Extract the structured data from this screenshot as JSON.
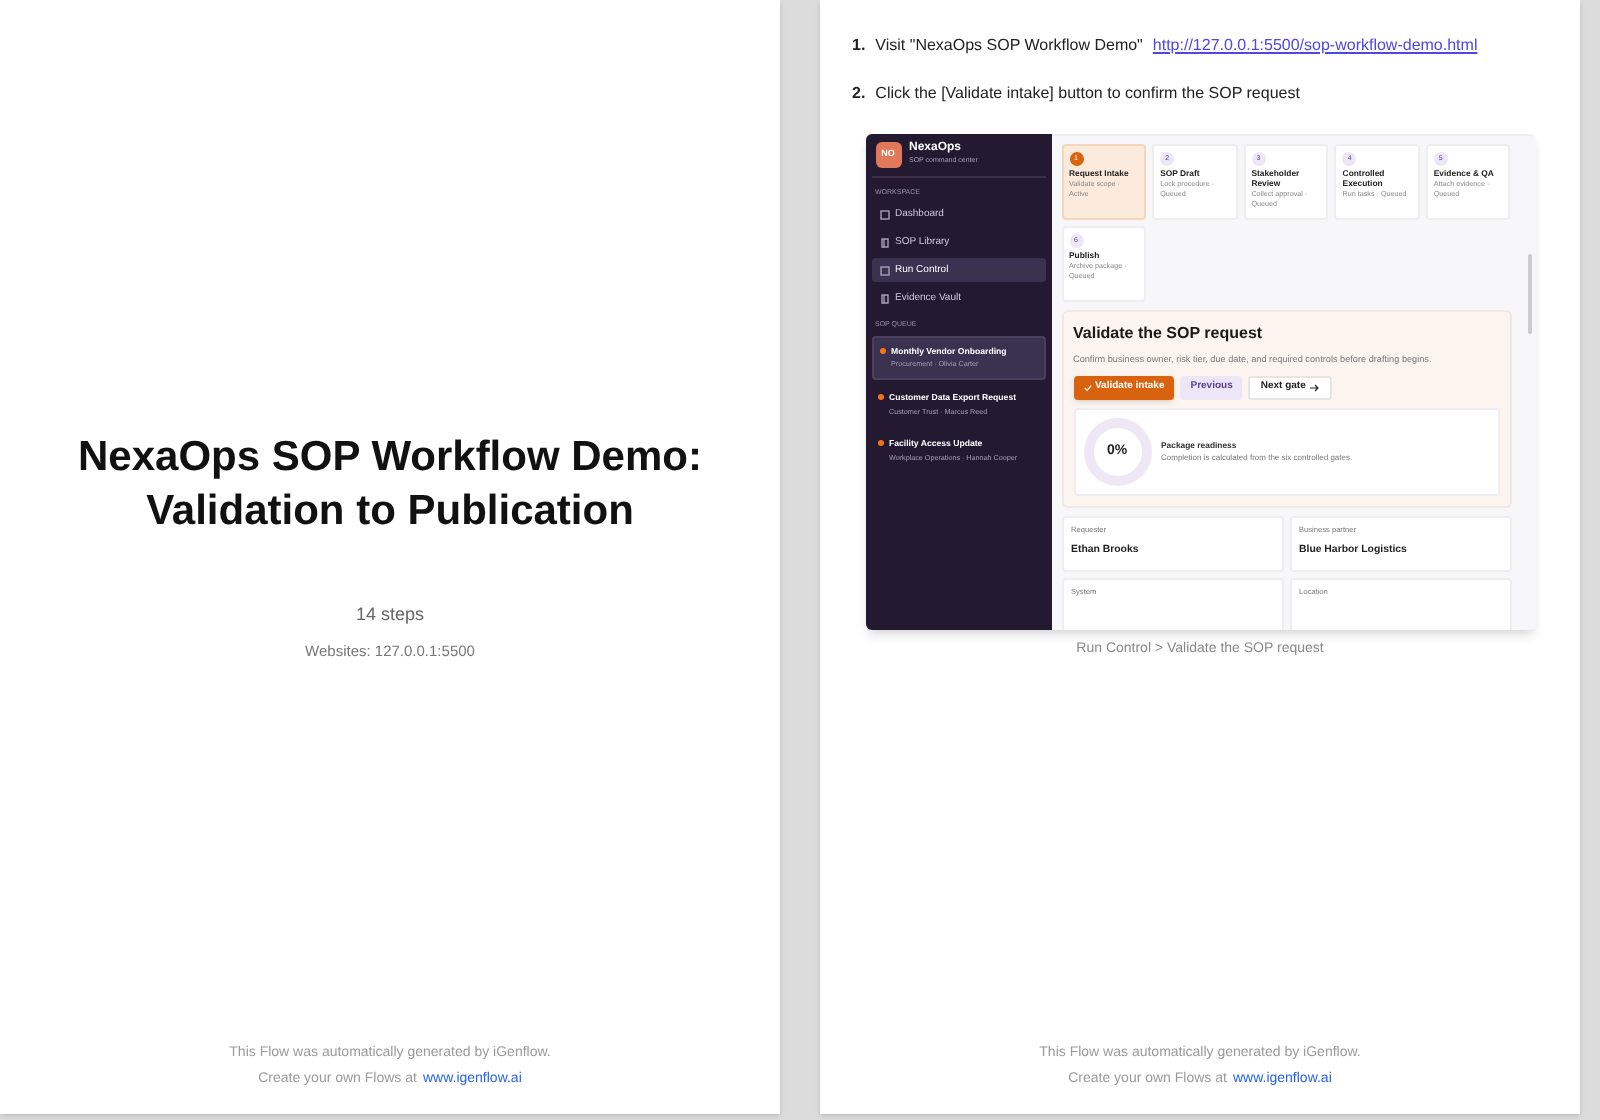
{
  "left_page": {
    "title": "NexaOps SOP Workflow Demo: Validation to Publication",
    "steps_count": "14 steps",
    "websites": "Websites: 127.0.0.1:5500",
    "footer": {
      "note": "This Flow was automatically generated by iGenflow.",
      "cta": "Create your own Flows at",
      "link": "www.igenflow.ai"
    }
  },
  "right_page": {
    "steps": [
      {
        "number": "1.",
        "text": "Visit \"NexaOps SOP Workflow Demo\"",
        "link": "http://127.0.0.1:5500/sop-workflow-demo.html"
      },
      {
        "number": "2.",
        "text": "Click the [Validate intake] button to confirm the SOP request"
      }
    ],
    "screenshot": {
      "brand": {
        "initials": "NO",
        "name": "NexaOps",
        "subtitle": "SOP command center"
      },
      "workspace_label": "WORKSPACE",
      "nav": [
        {
          "label": "Dashboard",
          "selected": false
        },
        {
          "label": "SOP Library",
          "selected": false
        },
        {
          "label": "Run Control",
          "selected": true
        },
        {
          "label": "Evidence Vault",
          "selected": false
        }
      ],
      "queue_label": "SOP QUEUE",
      "queue": [
        {
          "title": "Monthly Vendor Onboarding",
          "meta": "Procurement · Olivia Carter",
          "selected": true,
          "color": "#f97316"
        },
        {
          "title": "Customer Data Export Request",
          "meta": "Customer Trust · Marcus Reed",
          "selected": false,
          "color": "#f97316"
        },
        {
          "title": "Facility Access Update",
          "meta": "Workplace Operations · Hannah Cooper",
          "selected": false,
          "color": "#f97316"
        }
      ],
      "gates": [
        {
          "number": "1",
          "title": "Request Intake",
          "status": "Validate scope · Active",
          "selected": true
        },
        {
          "number": "2",
          "title": "SOP Draft",
          "status": "Lock procedure · Queued",
          "selected": false
        },
        {
          "number": "3",
          "title": "Stakeholder Review",
          "status": "Collect approval · Queued",
          "selected": false
        },
        {
          "number": "4",
          "title": "Controlled Execution",
          "status": "Run tasks · Queued",
          "selected": false
        },
        {
          "number": "5",
          "title": "Evidence & QA",
          "status": "Attach evidence · Queued",
          "selected": false
        },
        {
          "number": "6",
          "title": "Publish",
          "status": "Archive package · Queued",
          "selected": false
        }
      ],
      "panel": {
        "title": "Validate the SOP request",
        "description": "Confirm business owner, risk tier, due date, and required controls before drafting begins.",
        "buttons": [
          {
            "label": "Validate intake",
            "kind": "primary"
          },
          {
            "label": "Previous",
            "kind": "secondary"
          },
          {
            "label": "Next gate",
            "kind": "next"
          }
        ],
        "readiness": {
          "percent": "0%",
          "title": "Package readiness",
          "text": "Completion is calculated from the six controlled gates."
        }
      },
      "fields": [
        {
          "label": "Requester",
          "value": "Ethan Brooks"
        },
        {
          "label": "Business partner",
          "value": "Blue Harbor Logistics"
        },
        {
          "label": "System"
        },
        {
          "label": "Location"
        }
      ]
    },
    "caption": "Run Control > Validate the SOP request",
    "footer": {
      "note": "This Flow was automatically generated by iGenflow.",
      "cta": "Create your own Flows at",
      "link": "www.igenflow.ai"
    }
  }
}
